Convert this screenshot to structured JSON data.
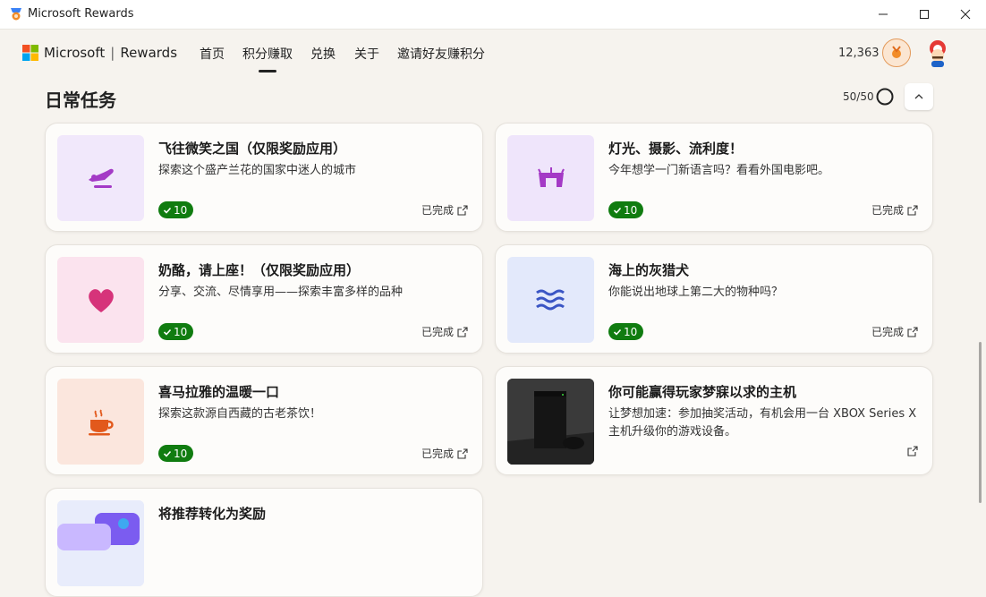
{
  "window": {
    "title": "Microsoft Rewards"
  },
  "brand": {
    "microsoft": "Microsoft",
    "separator": "|",
    "rewards": "Rewards"
  },
  "nav": {
    "home": "首页",
    "earn": "积分赚取",
    "redeem": "兑换",
    "about": "关于",
    "refer": "邀请好友赚积分"
  },
  "account": {
    "points": "12,363"
  },
  "section": {
    "title": "日常任务",
    "progress": "50/50"
  },
  "cards": [
    {
      "title": "飞往微笑之国（仅限奖励应用）",
      "desc": "探索这个盛产兰花的国家中迷人的城市",
      "points": "10",
      "status": "已完成",
      "icon": "airplane-icon",
      "bg": "#f1e8fb"
    },
    {
      "title": "灯光、摄影、流利度！",
      "desc": "今年想学一门新语言吗？看看外国电影吧。",
      "points": "10",
      "status": "已完成",
      "icon": "theater-icon",
      "bg": "#efe5fb"
    },
    {
      "title": "奶酪，请上座！（仅限奖励应用）",
      "desc": "分享、交流、尽情享用——探索丰富多样的品种",
      "points": "10",
      "status": "已完成",
      "icon": "heart-icon",
      "bg": "#fbe3ee"
    },
    {
      "title": "海上的灰猎犬",
      "desc": "你能说出地球上第二大的物种吗？",
      "points": "10",
      "status": "已完成",
      "icon": "waves-icon",
      "bg": "#e3e9fb"
    },
    {
      "title": "喜马拉雅的温暖一口",
      "desc": "探索这款源自西藏的古老茶饮！",
      "points": "10",
      "status": "已完成",
      "icon": "teacup-icon",
      "bg": "#fbe6dd"
    },
    {
      "title": "你可能赢得玩家梦寐以求的主机",
      "desc": "让梦想加速：参加抽奖活动，有机会用一台 XBOX Series X 主机升级你的游戏设备。",
      "points": "",
      "status": "",
      "icon": "xbox-console-image",
      "bg": "#2a2a2a"
    },
    {
      "title": "将推荐转化为奖励",
      "desc": "",
      "points": "",
      "status": "",
      "icon": "referral-image",
      "bg": "#e8ecfb"
    }
  ],
  "colors": {
    "accent": "#107c10",
    "background": "#f6f3ee"
  }
}
